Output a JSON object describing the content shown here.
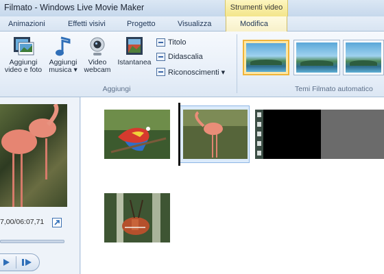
{
  "window": {
    "title": "Filmato - Windows Live Movie Maker"
  },
  "contextual_tab": {
    "label": "Strumenti video"
  },
  "tabs": [
    {
      "label": "Animazioni"
    },
    {
      "label": "Effetti visivi"
    },
    {
      "label": "Progetto"
    },
    {
      "label": "Visualizza"
    },
    {
      "label": "Modifica"
    }
  ],
  "ribbon": {
    "add_video_photo": {
      "line1": "Aggiungi",
      "line2": "video e foto"
    },
    "add_music": {
      "line1": "Aggiungi",
      "line2": "musica ▾"
    },
    "webcam_video": {
      "line1": "Video",
      "line2": "webcam"
    },
    "snapshot": {
      "label": "Istantanea"
    },
    "title": {
      "label": "Titolo"
    },
    "caption": {
      "label": "Didascalia"
    },
    "credits": {
      "label": "Riconoscimenti ▾"
    },
    "group_add": "Aggiungi",
    "group_themes": "Temi Filmato automatico"
  },
  "preview": {
    "timecode": "7,00/06:07,71"
  },
  "colors": {
    "accent_selected_theme": "#f0b43a",
    "contextual_tab": "#f3e58a",
    "clip_selection": "#8db6e4"
  }
}
